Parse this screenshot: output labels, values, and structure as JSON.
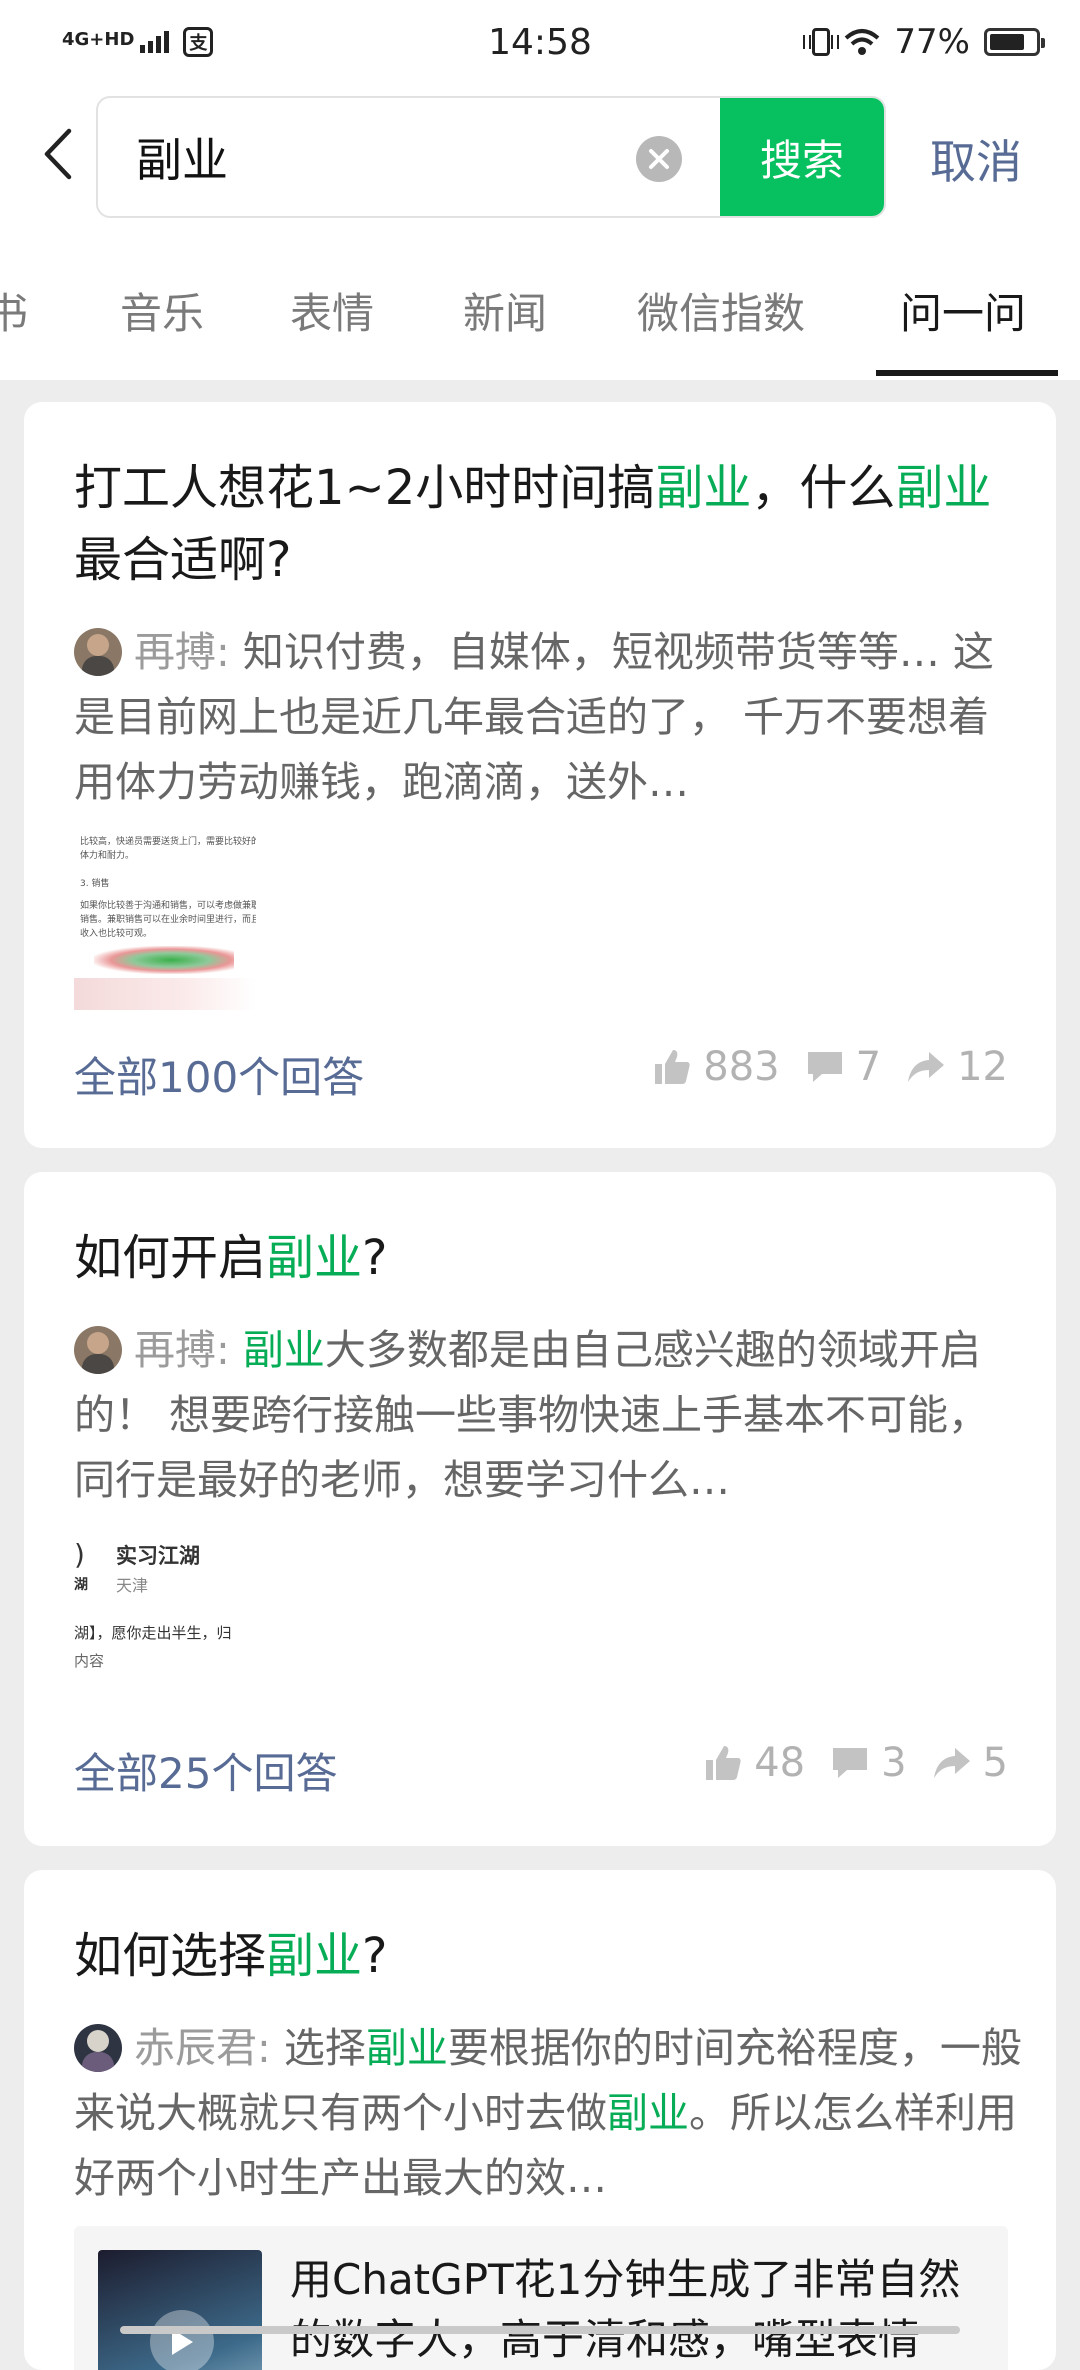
{
  "status_bar": {
    "network": "4G+HD",
    "time": "14:58",
    "battery_percent": "77%",
    "battery_level": 0.77
  },
  "search": {
    "query": "副业",
    "button_label": "搜索",
    "cancel_label": "取消"
  },
  "tabs": {
    "items": [
      "书",
      "音乐",
      "表情",
      "新闻",
      "微信指数",
      "问一问"
    ],
    "active_index": 5
  },
  "results": [
    {
      "title_parts": [
        "打工人想花1~2小时时间搞",
        "副业",
        "，什么",
        "副业",
        "最合适啊?"
      ],
      "author": "再搏:",
      "snippet": "知识付费，自媒体，短视频带货等等… 这是目前网上也是近几年最合适的了， 千万不要想着用体力劳动赚钱，跑滴滴，送外…",
      "thumb_texts": [
        "比较高，快递员需要送货上门，需要比较好的",
        "体力和耐力。",
        "3. 销售",
        "如果你比较善于沟通和销售，可以考虑做兼职",
        "销售。兼职销售可以在业余时间里进行，而且",
        "收入也比较可观。"
      ],
      "answers_label": "全部100个回答",
      "likes": "883",
      "comments": "7",
      "shares": "12"
    },
    {
      "title_parts": [
        "如何开启",
        "副业",
        "?"
      ],
      "author": "再搏:",
      "snippet_parts": [
        "副业",
        "大多数都是由自己感兴趣的领域开启的！ 想要跨行接触一些事物快速上手基本不可能，同行是最好的老师，想要学习什么…"
      ],
      "thumb_texts": [
        ")",
        "实习江湖",
        "湖",
        "天津",
        "湖】，愿你走出半生，归",
        "内容"
      ],
      "answers_label": "全部25个回答",
      "likes": "48",
      "comments": "3",
      "shares": "5"
    },
    {
      "title_parts": [
        "如何选择",
        "副业",
        "?"
      ],
      "author": "赤辰君:",
      "snippet_parts": [
        "选择",
        "副业",
        "要根据你的时间充裕程度，一般来说大概就只有两个小时去做",
        "副业",
        "。所以怎么样利用好两个小时生产出最大的效…"
      ],
      "video_title": "用ChatGPT花1分钟生成了非常自然的数字人，高于清和感，嘴型表情"
    }
  ],
  "colors": {
    "brand_green": "#07c160",
    "highlight_green": "#07ad56",
    "link_blue": "#576b95"
  }
}
